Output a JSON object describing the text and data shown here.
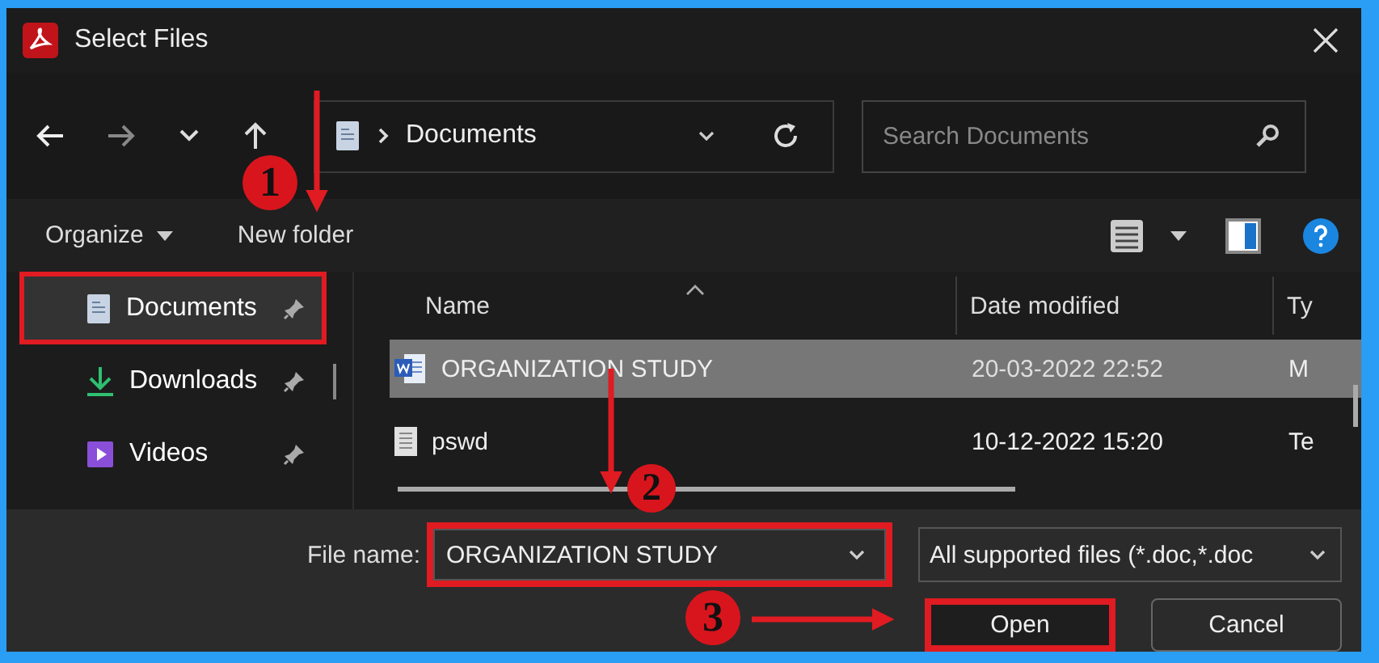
{
  "window": {
    "title": "Select Files"
  },
  "nav": {
    "path": [
      "Documents"
    ],
    "search": {
      "placeholder": "Search Documents"
    }
  },
  "toolbar": {
    "organize": "Organize",
    "new_folder": "New folder"
  },
  "sidebar": {
    "items": [
      {
        "label": "Documents",
        "kind": "documents",
        "selected": true,
        "annotated": true
      },
      {
        "label": "Downloads",
        "kind": "downloads",
        "selected": false,
        "annotated": false
      },
      {
        "label": "Videos",
        "kind": "videos",
        "selected": false,
        "annotated": false
      }
    ]
  },
  "files": {
    "columns": [
      "Name",
      "Date modified",
      "Ty"
    ],
    "rows": [
      {
        "name": "ORGANIZATION STUDY",
        "kind": "word",
        "date": "20-03-2022 22:52",
        "type": "M",
        "selected": true
      },
      {
        "name": "pswd",
        "kind": "text",
        "date": "10-12-2022 15:20",
        "type": "Te",
        "selected": false
      }
    ]
  },
  "footer": {
    "file_name_label": "File name:",
    "file_name": "ORGANIZATION STUDY",
    "file_name_annotated": true,
    "filter": "All supported files (*.doc,*.doc",
    "buttons": [
      {
        "label": "Open",
        "annotated": true
      },
      {
        "label": "Cancel",
        "annotated": false
      }
    ]
  },
  "callouts": [
    {
      "number": "1"
    },
    {
      "number": "2"
    },
    {
      "number": "3"
    }
  ]
}
